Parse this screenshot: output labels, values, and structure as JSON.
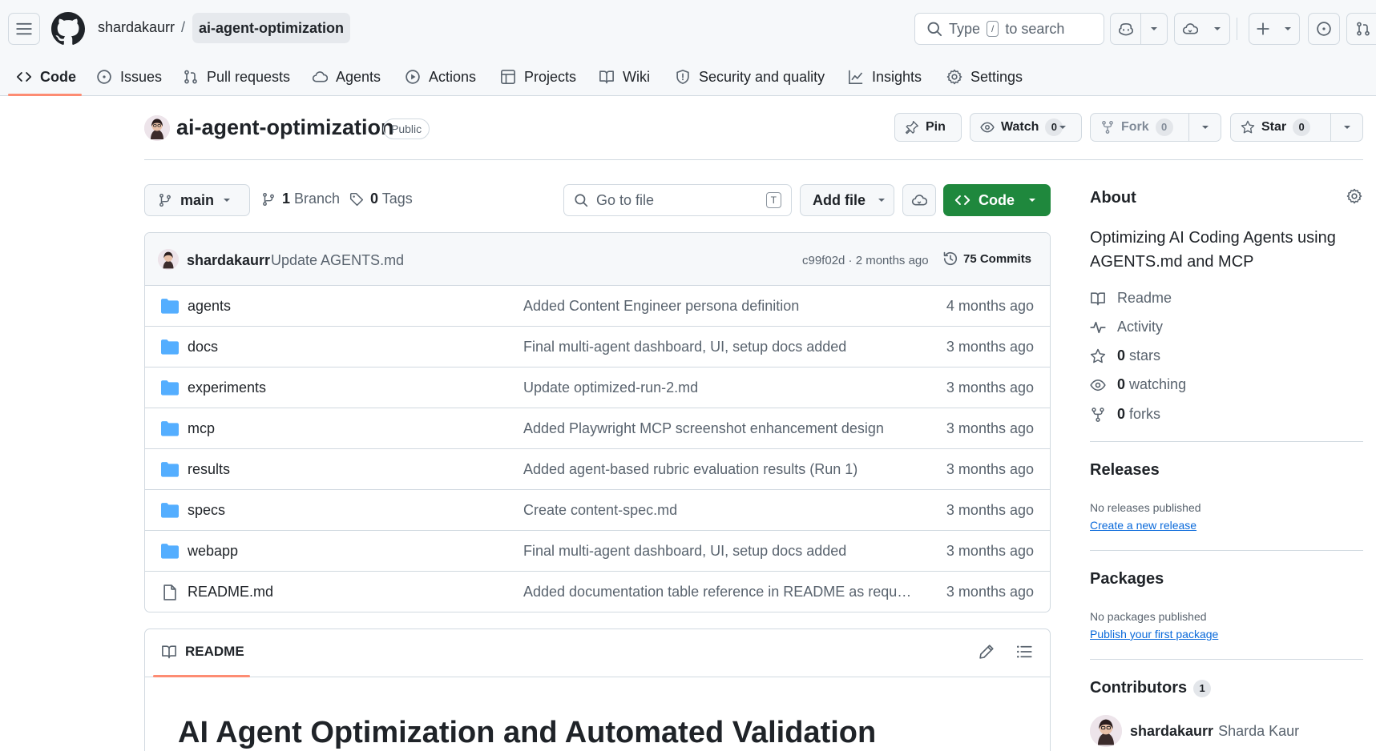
{
  "header": {
    "owner": "shardakaurr",
    "separator": "/",
    "repo": "ai-agent-optimization",
    "search_placeholder_pre": "Type",
    "search_key": "/",
    "search_placeholder_post": "to search"
  },
  "tabs": [
    {
      "label": "Code",
      "icon": "code-icon",
      "active": true
    },
    {
      "label": "Issues",
      "icon": "issue-icon"
    },
    {
      "label": "Pull requests",
      "icon": "pull-request-icon"
    },
    {
      "label": "Agents",
      "icon": "agents-icon"
    },
    {
      "label": "Actions",
      "icon": "play-icon"
    },
    {
      "label": "Projects",
      "icon": "table-icon"
    },
    {
      "label": "Wiki",
      "icon": "book-icon"
    },
    {
      "label": "Security and quality",
      "icon": "shield-icon"
    },
    {
      "label": "Insights",
      "icon": "graph-icon"
    },
    {
      "label": "Settings",
      "icon": "gear-icon"
    }
  ],
  "repo": {
    "title": "ai-agent-optimization",
    "visibility": "Public",
    "pin_label": "Pin",
    "watch_label": "Watch",
    "watch_count": "0",
    "fork_label": "Fork",
    "fork_count": "0",
    "star_label": "Star",
    "star_count": "0"
  },
  "filenav": {
    "branch": "main",
    "branch_count": "1",
    "branch_label": "Branch",
    "tag_count": "0",
    "tag_label": "Tags",
    "goto_placeholder": "Go to file",
    "goto_key": "T",
    "add_file": "Add file",
    "code": "Code"
  },
  "commit": {
    "author": "shardakaurr",
    "message": "Update AGENTS.md",
    "meta": "c99f02d · 2 months ago",
    "count": "75 Commits"
  },
  "files": [
    {
      "name": "agents",
      "type": "dir",
      "message": "Added Content Engineer persona definition",
      "date": "4 months ago"
    },
    {
      "name": "docs",
      "type": "dir",
      "message": "Final multi-agent dashboard, UI, setup docs added",
      "date": "3 months ago"
    },
    {
      "name": "experiments",
      "type": "dir",
      "message": "Update optimized-run-2.md",
      "date": "3 months ago"
    },
    {
      "name": "mcp",
      "type": "dir",
      "message": "Added Playwright MCP screenshot enhancement design",
      "date": "3 months ago"
    },
    {
      "name": "results",
      "type": "dir",
      "message": "Added agent-based rubric evaluation results (Run 1)",
      "date": "3 months ago"
    },
    {
      "name": "specs",
      "type": "dir",
      "message": "Create content-spec.md",
      "date": "3 months ago"
    },
    {
      "name": "webapp",
      "type": "dir",
      "message": "Final multi-agent dashboard, UI, setup docs added",
      "date": "3 months ago"
    },
    {
      "name": "README.md",
      "type": "file",
      "message": "Added documentation table reference in README as request...",
      "date": "3 months ago"
    }
  ],
  "readme": {
    "tab": "README",
    "heading": "AI Agent Optimization and Automated Validation"
  },
  "about": {
    "title": "About",
    "description": "Optimizing AI Coding Agents using AGENTS.md and MCP",
    "readme": "Readme",
    "activity": "Activity",
    "stars_count": "0",
    "stars_label": "stars",
    "watching_count": "0",
    "watching_label": "watching",
    "forks_count": "0",
    "forks_label": "forks"
  },
  "releases": {
    "title": "Releases",
    "note": "No releases published",
    "link": "Create a new release"
  },
  "packages": {
    "title": "Packages",
    "note": "No packages published",
    "link": "Publish your first package"
  },
  "contributors": {
    "title": "Contributors",
    "count": "1",
    "login": "shardakaurr",
    "name": "Sharda Kaur"
  },
  "colors": {
    "accent": "#fd8c73",
    "primary_button": "#1f883d",
    "link": "#0969da",
    "folder": "#54aeff"
  }
}
